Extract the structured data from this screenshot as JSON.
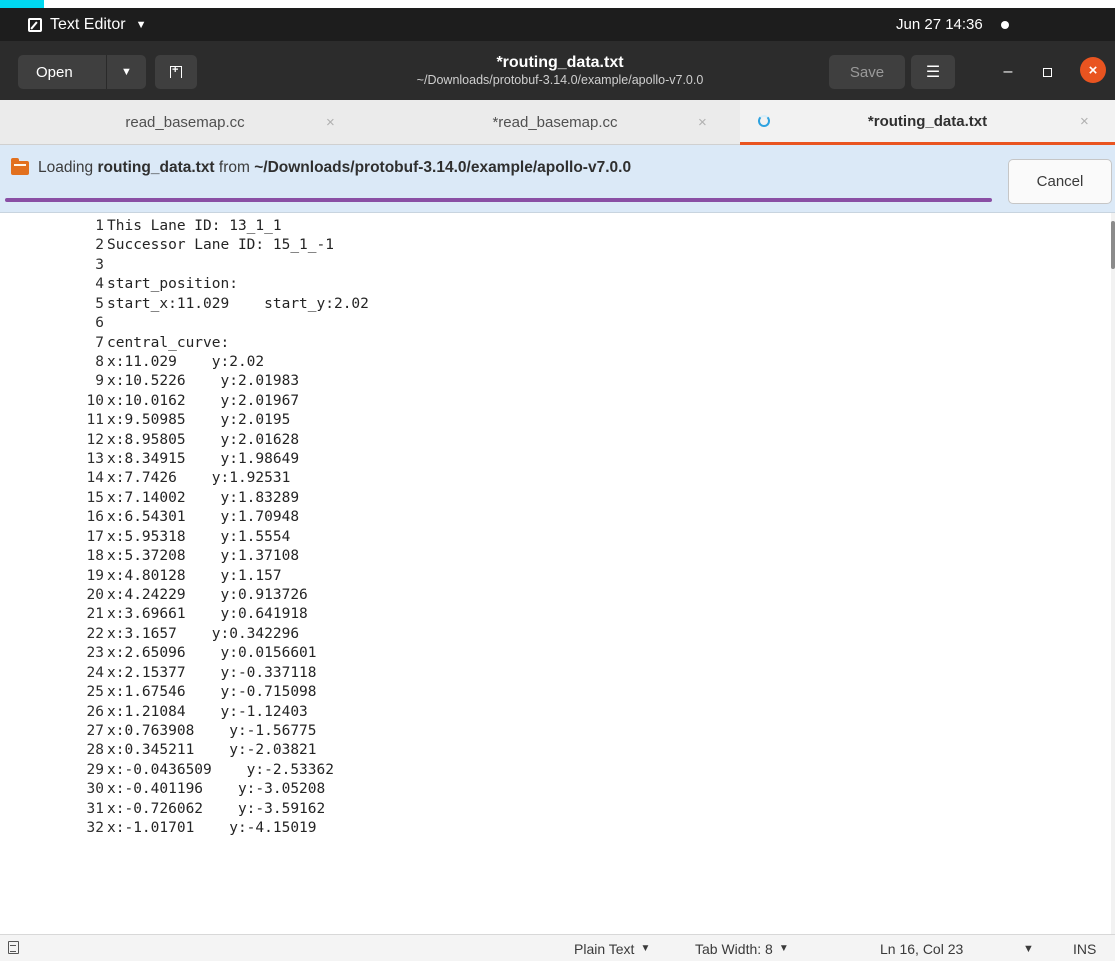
{
  "topbar": {
    "app_name": "Text Editor",
    "datetime": "Jun 27  14:36"
  },
  "header": {
    "open_label": "Open",
    "title": "*routing_data.txt",
    "path": "~/Downloads/protobuf-3.14.0/example/apollo-v7.0.0",
    "save_label": "Save"
  },
  "tabs": [
    {
      "label": "read_basemap.cc",
      "close": "×"
    },
    {
      "label": "*read_basemap.cc",
      "close": "×"
    },
    {
      "label": "*routing_data.txt",
      "close": "×",
      "active": true
    }
  ],
  "infobar": {
    "prefix": "Loading ",
    "file": "routing_data.txt",
    "middle": " from ",
    "dir": "~/Downloads/protobuf-3.14.0/example/apollo-v7.0.0",
    "cancel_label": "Cancel"
  },
  "editor": {
    "lines": [
      {
        "n": "1",
        "t": "This Lane ID: 13_1_1"
      },
      {
        "n": "2",
        "t": "Successor Lane ID: 15_1_-1"
      },
      {
        "n": "3",
        "t": ""
      },
      {
        "n": "4",
        "t": "start_position:"
      },
      {
        "n": "5",
        "t": "start_x:11.029    start_y:2.02"
      },
      {
        "n": "6",
        "t": ""
      },
      {
        "n": "7",
        "t": "central_curve:"
      },
      {
        "n": "8",
        "t": "x:11.029    y:2.02"
      },
      {
        "n": "9",
        "t": "x:10.5226    y:2.01983"
      },
      {
        "n": "10",
        "t": "x:10.0162    y:2.01967"
      },
      {
        "n": "11",
        "t": "x:9.50985    y:2.0195"
      },
      {
        "n": "12",
        "t": "x:8.95805    y:2.01628"
      },
      {
        "n": "13",
        "t": "x:8.34915    y:1.98649"
      },
      {
        "n": "14",
        "t": "x:7.7426    y:1.92531"
      },
      {
        "n": "15",
        "t": "x:7.14002    y:1.83289"
      },
      {
        "n": "16",
        "t": "x:6.54301    y:1.70948"
      },
      {
        "n": "17",
        "t": "x:5.95318    y:1.5554"
      },
      {
        "n": "18",
        "t": "x:5.37208    y:1.37108"
      },
      {
        "n": "19",
        "t": "x:4.80128    y:1.157"
      },
      {
        "n": "20",
        "t": "x:4.24229    y:0.913726"
      },
      {
        "n": "21",
        "t": "x:3.69661    y:0.641918"
      },
      {
        "n": "22",
        "t": "x:3.1657    y:0.342296"
      },
      {
        "n": "23",
        "t": "x:2.65096    y:0.0156601"
      },
      {
        "n": "24",
        "t": "x:2.15377    y:-0.337118"
      },
      {
        "n": "25",
        "t": "x:1.67546    y:-0.715098"
      },
      {
        "n": "26",
        "t": "x:1.21084    y:-1.12403"
      },
      {
        "n": "27",
        "t": "x:0.763908    y:-1.56775"
      },
      {
        "n": "28",
        "t": "x:0.345211    y:-2.03821"
      },
      {
        "n": "29",
        "t": "x:-0.0436509    y:-2.53362"
      },
      {
        "n": "30",
        "t": "x:-0.401196    y:-3.05208"
      },
      {
        "n": "31",
        "t": "x:-0.726062    y:-3.59162"
      },
      {
        "n": "32",
        "t": "x:-1.01701    y:-4.15019"
      }
    ]
  },
  "statusbar": {
    "language": "Plain Text",
    "tab_width": "Tab Width: 8",
    "position": "Ln 16, Col 23",
    "mode": "INS"
  },
  "colors": {
    "accent": "#e95420",
    "progress": "#8a4fa4",
    "infobar": "#dbe9f7"
  }
}
